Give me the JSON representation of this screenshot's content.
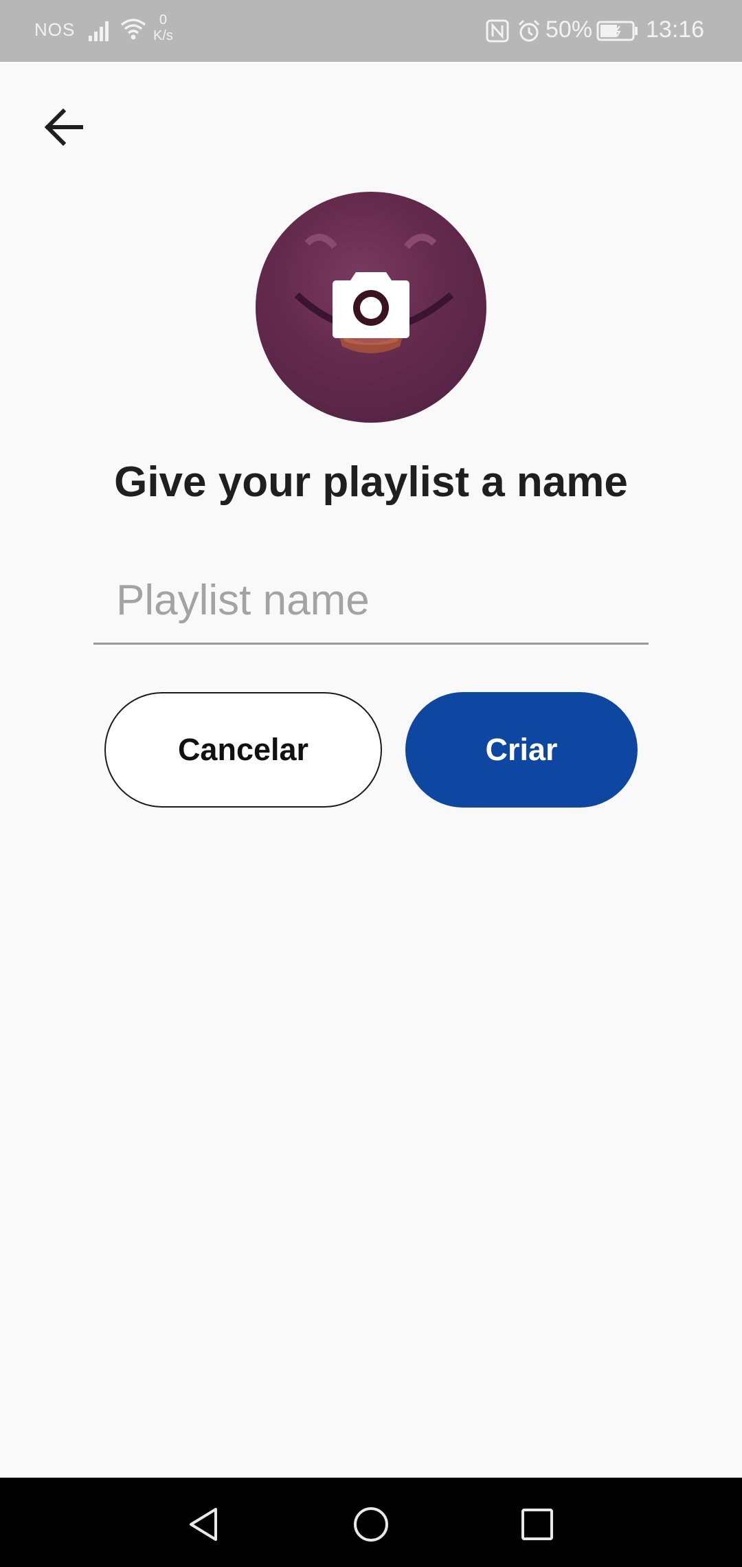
{
  "status_bar": {
    "carrier": "NOS",
    "speed_value": "0",
    "speed_unit": "K/s",
    "battery_percent": "50%",
    "time": "13:16",
    "icons": [
      "signal-icon",
      "wifi-icon",
      "nfc-icon",
      "alarm-icon",
      "battery-icon"
    ]
  },
  "header": {
    "back_icon": "arrow-left-icon"
  },
  "avatar": {
    "icon": "camera-icon",
    "accent_color": "#632a4c"
  },
  "title": "Give your playlist a name",
  "input": {
    "placeholder": "Playlist name",
    "value": ""
  },
  "buttons": {
    "cancel_label": "Cancelar",
    "create_label": "Criar",
    "create_color": "#0d47a1"
  },
  "nav_bar": {
    "icons": [
      "nav-back-icon",
      "nav-home-icon",
      "nav-recents-icon"
    ]
  }
}
